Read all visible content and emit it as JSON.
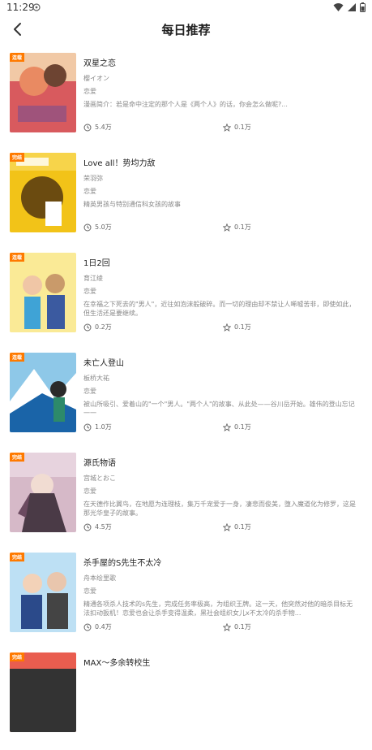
{
  "status": {
    "time": "11:29"
  },
  "header": {
    "title": "每日推荐"
  },
  "items": [
    {
      "title": "双星之恋",
      "author": "樱イオン",
      "genre": "恋爱",
      "desc": "漫画简介：若是命中注定的那个人是《两个人》的话，你会怎么做呢?...",
      "views": "5.4万",
      "likes": "0.1万",
      "tag": "连载",
      "cover_colors": [
        "#e7b28f",
        "#c44a56"
      ]
    },
    {
      "title": "Love all！势均力敌",
      "author": "荣羽弥",
      "genre": "恋爱",
      "desc": "精英男孩与特别通信科女孩的故事",
      "views": "5.0万",
      "likes": "0.1万",
      "tag": "完结",
      "cover_colors": [
        "#f2c318",
        "#6b4b10"
      ]
    },
    {
      "title": "1日2回",
      "author": "育江绫",
      "genre": "恋爱",
      "desc": "在幸福之下死去的\"男人\"，近往如泡沫般破碎。而一切的理由却不禁让人唏嘘苦非，即使如此，但生活还是要继续。",
      "views": "0.2万",
      "likes": "0.1万",
      "tag": "连载",
      "cover_colors": [
        "#f6e27b",
        "#3fa3d6"
      ]
    },
    {
      "title": "未亡人登山",
      "author": "板桥大祐",
      "genre": "恋爱",
      "desc": "被山所吸引、爱着山的\"一个\"男人。\"两个人\"的故事、从此处——谷川岳开始。雄伟的登山忘记一一",
      "views": "1.0万",
      "likes": "0.1万",
      "tag": "连载",
      "cover_colors": [
        "#1a64a8",
        "#8ec8e8"
      ]
    },
    {
      "title": "源氏物语",
      "author": "宫城とおこ",
      "genre": "恋爱",
      "desc": "在天德作比翼鸟，在地愿为连理枝，集万千宠爱于一身，凄悲而俊美，堕入魔道化为修罗，这是那光华皇子的故事。",
      "views": "4.5万",
      "likes": "0.1万",
      "tag": "完结",
      "cover_colors": [
        "#d6b9c8",
        "#4a3a46"
      ]
    },
    {
      "title": "杀手屋的S先生不太冷",
      "author": "舟本绘里歌",
      "genre": "恋爱",
      "desc": "精通各项杀人技术的s先生，完成任务率极高，为组织王牌。这一天，他突然对他的暗杀目标无法扣动扳机！恋爱也会让杀手变得温柔，黑社会组织女儿x不太冷的杀手物...",
      "views": "0.4万",
      "likes": "0.1万",
      "tag": "完结",
      "cover_colors": [
        "#9fd2ef",
        "#2b4a8a"
      ]
    },
    {
      "title": "MAX～多余转校生",
      "author": "",
      "genre": "",
      "desc": "",
      "views": "",
      "likes": "",
      "tag": "完结",
      "cover_colors": [
        "#e95d4f",
        "#333333"
      ]
    }
  ]
}
